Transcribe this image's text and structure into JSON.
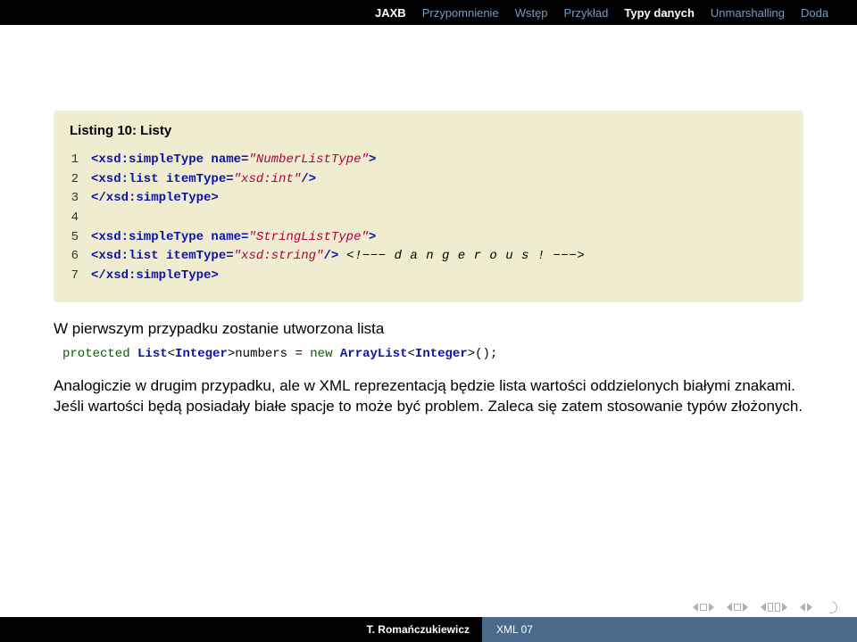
{
  "nav": {
    "items": [
      {
        "label": "JAXB",
        "active": true
      },
      {
        "label": "Przypomnienie",
        "active": false
      },
      {
        "label": "Wstęp",
        "active": false
      },
      {
        "label": "Przykład",
        "active": false
      },
      {
        "label": "Typy danych",
        "active": true
      },
      {
        "label": "Unmarshalling",
        "active": false
      },
      {
        "label": "Doda",
        "active": false
      }
    ]
  },
  "listing": {
    "title": "Listing 10: Listy",
    "lines": {
      "l1a": "<xsd:simpleType",
      "l1b": " name=",
      "l1c": "\"NumberListType\"",
      "l1d": ">",
      "l2a": "  <xsd:list",
      "l2b": " itemType=",
      "l2c": "\"xsd:int\"",
      "l2d": "/>",
      "l3a": "</xsd:simpleType>",
      "l5a": "<xsd:simpleType",
      "l5b": " name=",
      "l5c": "\"StringListType\"",
      "l5d": ">",
      "l6a": "  <xsd:list",
      "l6b": " itemType=",
      "l6c": "\"xsd:string\"",
      "l6d": "/>",
      "l6e": "   <!−−− d a n g e r o u s ! −−−>",
      "l7a": "</xsd:simpleType>"
    }
  },
  "body": {
    "p1": "W pierwszym przypadku zostanie utworzona lista",
    "proto": {
      "kw1": "protected",
      "t1": " List",
      "lt1": "<",
      "ty1": "Integer",
      "gt1": ">",
      "t2": "numbers = ",
      "kw2": "new",
      "t3": " ArrayList",
      "lt2": "<",
      "ty2": "Integer",
      "gt2": ">",
      "t4": "();"
    },
    "p2": "Analogiczie w drugim przypadku, ale w XML reprezentacją będzie lista wartości oddzielonych białymi znakami. Jeśli wartości będą posiadały białe spacje to może być problem. Zaleca się zatem stosowanie typów złożonych."
  },
  "footer": {
    "author": "T. Romańczukiewicz",
    "title": "XML 07"
  }
}
